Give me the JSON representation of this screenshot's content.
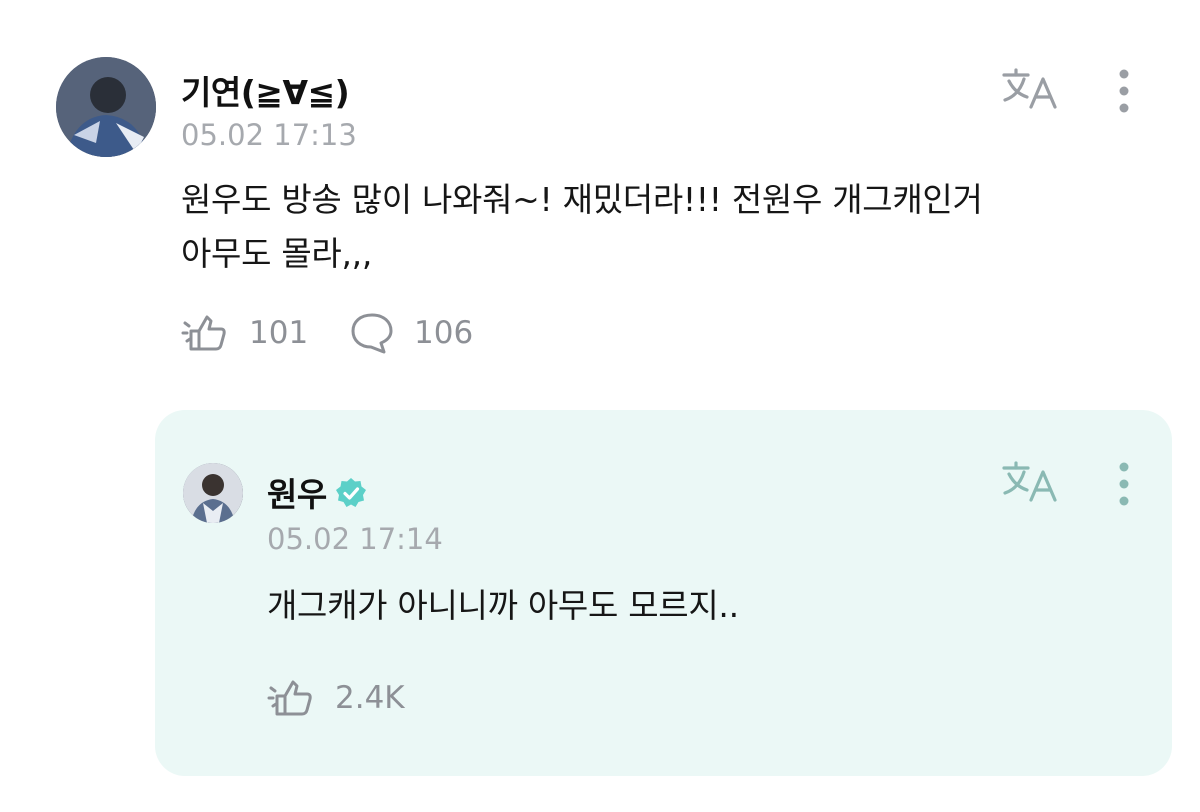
{
  "comment": {
    "author": "기연(≧∀≦)",
    "timestamp": "05.02 17:13",
    "text_line1": "원우도 방송 많이 나와줘~! 재밌더라!!! 전원우 개그캐인거",
    "text_line2": "아무도 몰라,,,",
    "likes": "101",
    "replies": "106",
    "icons": {
      "translate": "translate-icon",
      "more": "more-vertical-icon",
      "like": "like-icon",
      "reply": "reply-bubble-icon"
    }
  },
  "reply": {
    "author": "원우",
    "verified": true,
    "timestamp": "05.02 17:14",
    "text": "개그캐가 아니니까 아무도 모르지..",
    "likes": "2.4K",
    "background": "#ebf8f6",
    "badge_color": "#5cd0c8"
  },
  "colors": {
    "muted": "#a6a9ae",
    "icon": "#8d9096",
    "text": "#161616"
  }
}
